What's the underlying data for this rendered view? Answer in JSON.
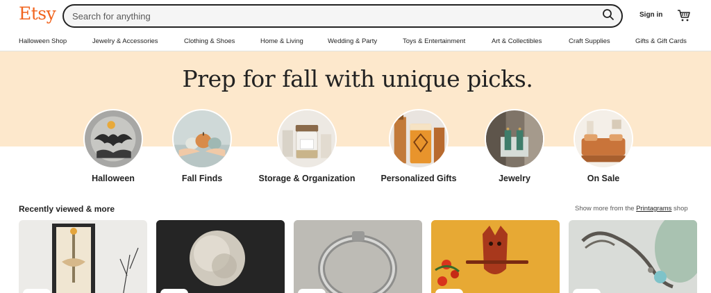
{
  "header": {
    "logo": "Etsy",
    "search_placeholder": "Search for anything",
    "signin_label": "Sign in"
  },
  "categories": [
    "Halloween Shop",
    "Jewelry & Accessories",
    "Clothing & Shoes",
    "Home & Living",
    "Wedding & Party",
    "Toys & Entertainment",
    "Art & Collectibles",
    "Craft Supplies",
    "Gifts & Gift Cards"
  ],
  "hero": {
    "title": "Prep for fall with unique picks.",
    "circles": [
      {
        "label": "Halloween"
      },
      {
        "label": "Fall Finds"
      },
      {
        "label": "Storage & Organization"
      },
      {
        "label": "Personalized Gifts"
      },
      {
        "label": "Jewelry"
      },
      {
        "label": "On Sale"
      }
    ]
  },
  "recent": {
    "title": "Recently viewed & more",
    "show_more_prefix": "Show more from the ",
    "shop_name": "Printagrams",
    "show_more_suffix": " shop"
  },
  "colors": {
    "brand": "#f1641e",
    "hero_band": "#fde8cc"
  }
}
